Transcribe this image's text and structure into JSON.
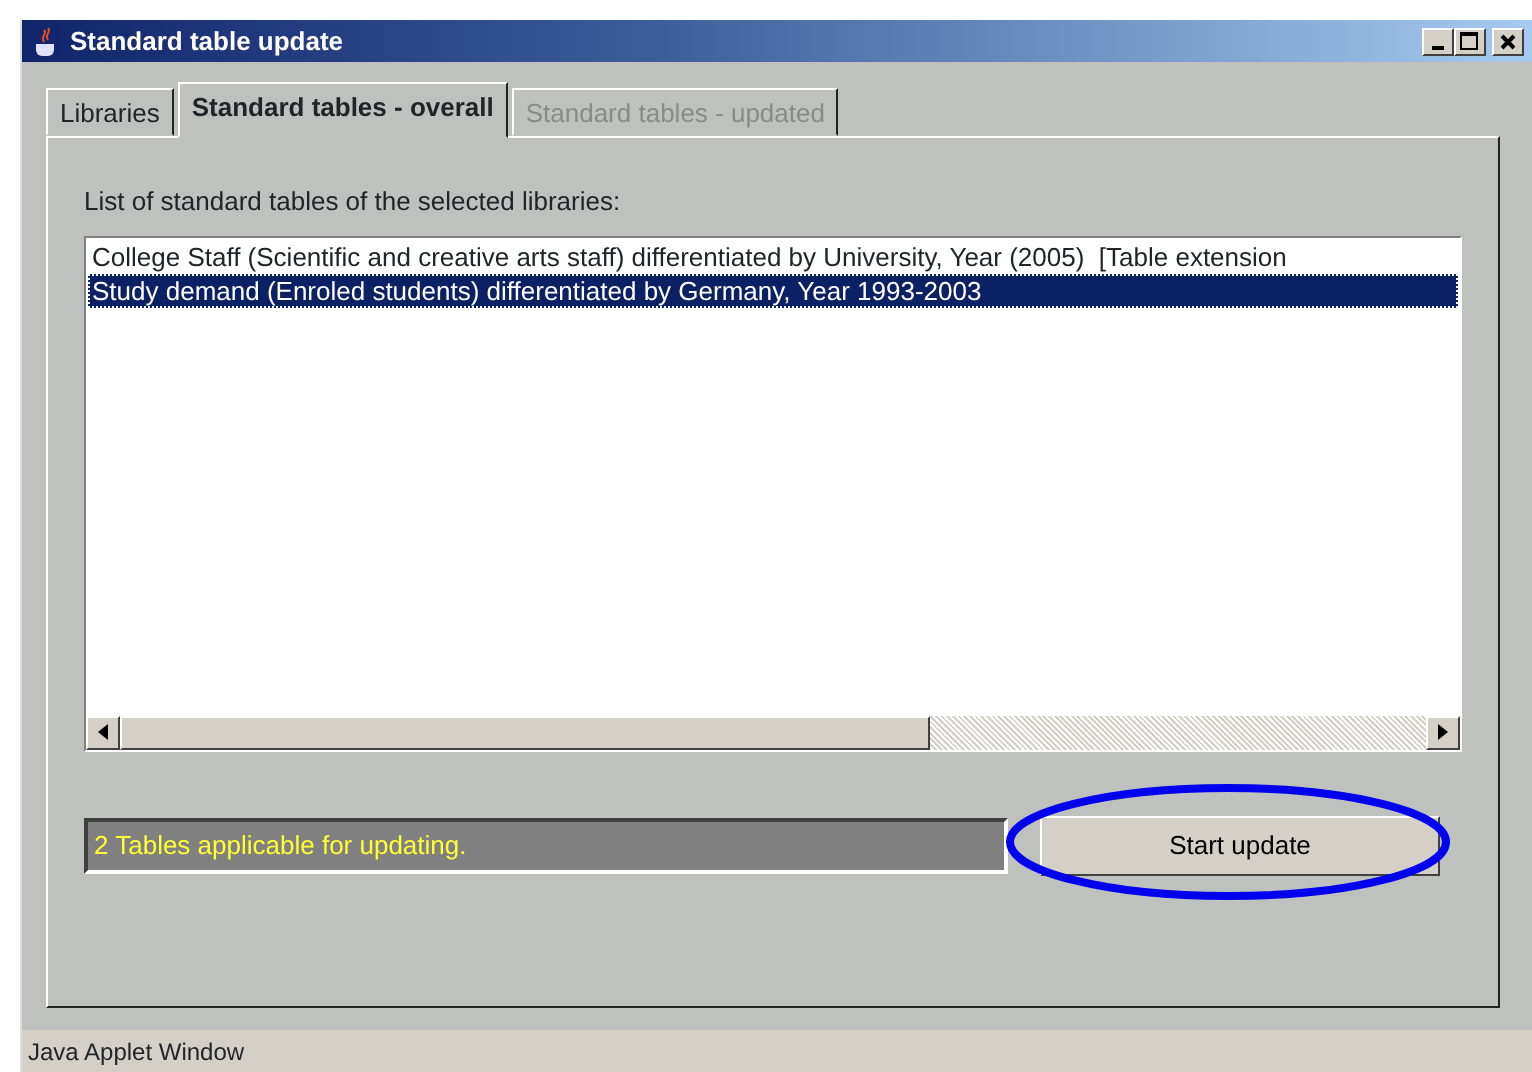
{
  "window": {
    "title": "Standard table update"
  },
  "tabs": [
    {
      "label": "Libraries",
      "selected": false,
      "disabled": false
    },
    {
      "label": "Standard tables - overall",
      "selected": true,
      "disabled": false
    },
    {
      "label": "Standard tables - updated",
      "selected": false,
      "disabled": true
    }
  ],
  "list": {
    "label": "List of standard tables of the selected libraries:",
    "items": [
      {
        "text": "College Staff (Scientific and creative arts staff) differentiated by University, Year (2005)  [Table extension",
        "selected": false
      },
      {
        "text": "Study demand (Enroled students) differentiated by Germany, Year 1993-2003",
        "selected": true
      }
    ]
  },
  "status_message": "2 Tables applicable for updating.",
  "start_button": {
    "label": "Start update",
    "highlighted": true
  },
  "status_bar": "Java Applet Window"
}
